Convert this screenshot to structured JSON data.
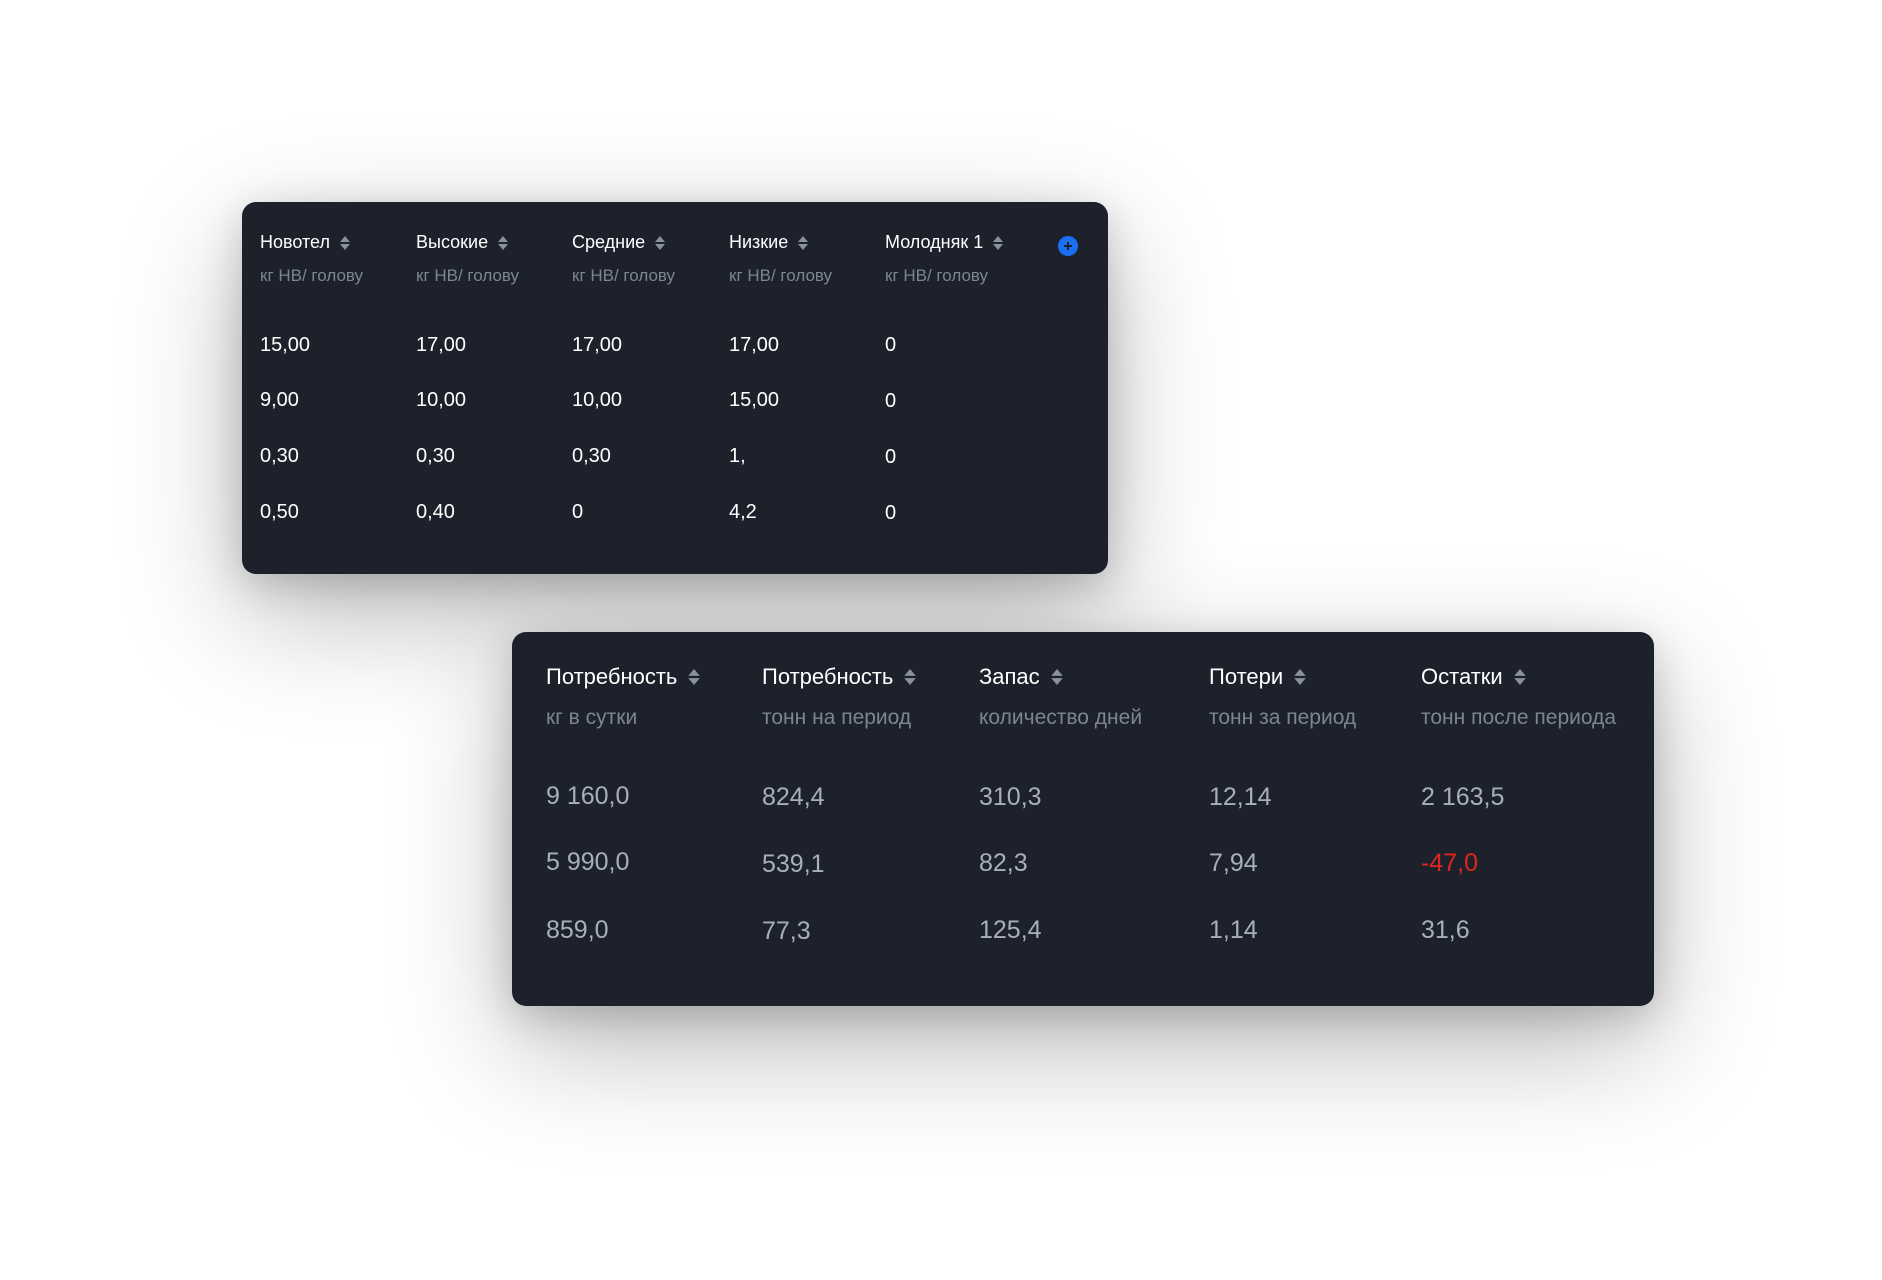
{
  "table_a": {
    "columns": [
      {
        "title": "Новотел",
        "unit": "кг НВ/ голову"
      },
      {
        "title": "Высокие",
        "unit": "кг НВ/ голову"
      },
      {
        "title": "Средние",
        "unit": "кг НВ/ голову"
      },
      {
        "title": "Низкие",
        "unit": "кг НВ/ голову"
      },
      {
        "title": "Молодняк 1",
        "unit": "кг НВ/ голову"
      }
    ],
    "rows": [
      [
        "15,00",
        "17,00",
        "17,00",
        "17,00",
        "0"
      ],
      [
        "9,00",
        "10,00",
        "10,00",
        "15,00",
        "0"
      ],
      [
        "0,30",
        "0,30",
        "0,30",
        "1,",
        "0"
      ],
      [
        "0,50",
        "0,40",
        "0",
        "4,2",
        "0"
      ]
    ],
    "add_icon": "plus-circle-icon",
    "accent_color": "#1b6ff2"
  },
  "table_b": {
    "columns": [
      {
        "title": "Потребность",
        "unit": "кг в сутки"
      },
      {
        "title": "Потребность",
        "unit": "тонн на период"
      },
      {
        "title": "Запас",
        "unit": "количество дней"
      },
      {
        "title": "Потери",
        "unit": "тонн за период"
      },
      {
        "title": "Остатки",
        "unit": "тонн после периода"
      }
    ],
    "rows": [
      [
        "9 160,0",
        "824,4",
        "310,3",
        "12,14",
        "2 163,5"
      ],
      [
        "5 990,0",
        "539,1",
        "82,3",
        "7,94",
        "-47,0"
      ],
      [
        "859,0",
        "77,3",
        "125,4",
        "1,14",
        "31,6"
      ]
    ],
    "negative_color": "#e0251f"
  },
  "theme": {
    "card_background": "#1c212b",
    "sort_icon": "sort-arrows-icon"
  }
}
